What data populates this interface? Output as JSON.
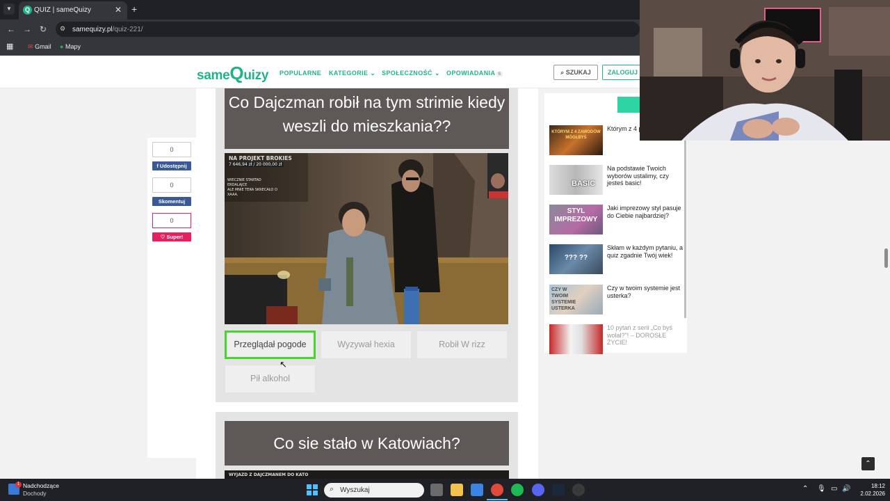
{
  "browser": {
    "tab_title": "QUIZ | sameQuizy",
    "tab_favicon": "Q",
    "url_host": "samequizy.pl",
    "url_path": "/quiz-221/",
    "bookmarks": [
      "Gmail",
      "Mapy"
    ]
  },
  "site": {
    "logo_part1": "same",
    "logo_part2": "Q",
    "logo_part3": "uizy",
    "nav": [
      "POPULARNE",
      "KATEGORIE",
      "SPOŁECZNOŚĆ",
      "OPOWIADANIA"
    ],
    "nav_badge": "6",
    "search_label": "SZUKAJ",
    "login_label": "ZALOGUJ",
    "accent_color": "#1fb38a"
  },
  "share": {
    "share_count": "0",
    "share_label": "Udostępnij",
    "comment_count": "0",
    "comment_label": "Skomentuj",
    "super_count": "0",
    "super_label": "Super!"
  },
  "question1": {
    "title": "Co Dajczman robił na tym strimie kiedy weszli do mieszkania??",
    "overlay_lines": [
      "NA PROJEKT BROKIES",
      "7 646,94 zł / 20 000,00 zł",
      "WIECZNIE STARTAD",
      "ERDALAJCE",
      "ALE MNIE TERA SKRECAŁO O",
      "XAAA."
    ],
    "answers": [
      "Przeglądał pogode",
      "Wyzywał hexia",
      "Robił W rizz",
      "Pił alkohol"
    ],
    "selected_index": 0
  },
  "question2": {
    "title": "Co sie stało w Katowiach?",
    "overlay_text": "WYJAZD Z DAJCZMANEM DO KATO"
  },
  "sidebar": {
    "items": [
      {
        "text": "Którym z 4 powinieneś",
        "thumb": "KTÓRYM Z 4 ZAWODÓW MÓGŁBYŚ"
      },
      {
        "text": "Na podstawie Twoich wyborów ustalimy, czy jesteś basic!",
        "thumb": "BASIC"
      },
      {
        "text": "Jaki imprezowy styl pasuje do Ciebie najbardziej?",
        "thumb": "STYL IMPREZOWY"
      },
      {
        "text": "Skłam w każdym pytaniu, a quiz zgadnie Twój wiek!",
        "thumb": "??? ??"
      },
      {
        "text": "Czy w twoim systemie jest usterka?",
        "thumb": "CZY W TWOIM SYSTEMIE USTERKA"
      },
      {
        "text": "10 pytań z serii „Co byś wolał?\"! – DOROSŁE ŻYCIE!",
        "thumb": ""
      }
    ]
  },
  "taskbar": {
    "notification_title": "Nadchodzące",
    "notification_sub": "Dochody",
    "notification_badge": "1",
    "search_placeholder": "Wyszukaj",
    "time": "18:12",
    "date": "2.02.2026"
  }
}
